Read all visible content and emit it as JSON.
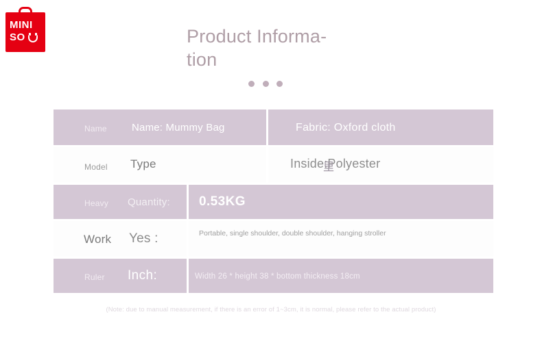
{
  "brand": {
    "name": "MINISO",
    "line1": "MINI",
    "line2": "SO",
    "color": "#e50012"
  },
  "header": {
    "title": "Product Informa-\ntion",
    "title_plain": "Product Information",
    "dot_count": 3,
    "accent_color": "#a9969f"
  },
  "table": {
    "rows": [
      {
        "label": "Name",
        "value": "Name: Mummy Bag",
        "right_value": "Fabric: Oxford cloth",
        "style": "shaded"
      },
      {
        "label": "Model",
        "value": "Type",
        "right_value": "Inside:Polyester",
        "right_cjk": "里",
        "style": "plain"
      },
      {
        "label": "Heavy",
        "value": "Quantity:",
        "right_value": "0.53KG",
        "style": "shaded"
      },
      {
        "label": "Work",
        "value": "Yes :",
        "right_value": "Portable, single shoulder, double shoulder, hanging stroller",
        "style": "plain"
      },
      {
        "label": "Ruler",
        "value": "Inch:",
        "right_value": "Width 26 * height 38 * bottom thickness 18cm",
        "style": "shaded"
      }
    ]
  },
  "footer": {
    "note": "(Note: due to manual measurement, if there is an error of 1~3cm, it is normal, please refer to the actual product)"
  },
  "colors": {
    "shaded_row": "#d4c7d5",
    "plain_row": "#fdfdfd",
    "page_background": "#ffffff"
  }
}
